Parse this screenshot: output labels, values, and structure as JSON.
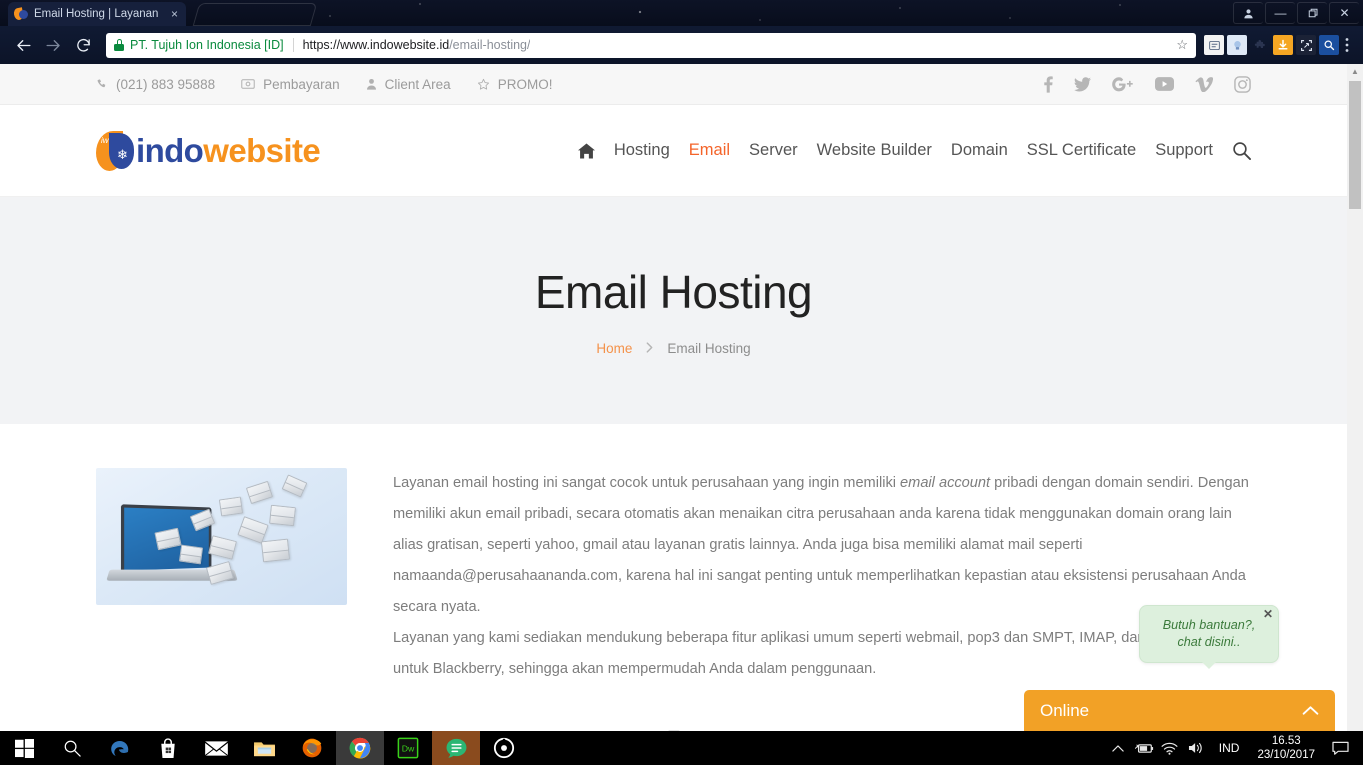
{
  "browser": {
    "tab": {
      "title": "Email Hosting | Layanan",
      "favicon": "indowebsite-favicon",
      "close": "×"
    },
    "nav": {
      "back": "←",
      "forward": "→",
      "reload": "⟳"
    },
    "omnibox": {
      "security_label": "PT. Tujuh Ion Indonesia [ID]",
      "url_host": "https://www.indowebsite.id",
      "url_path": "/email-hosting/",
      "bookmark_star": "☆"
    },
    "extensions": [
      "reader-icon",
      "lamp-icon",
      "puzzle-icon",
      "download-icon",
      "screenshot-icon",
      "search-ext-icon"
    ],
    "menu": "⋮",
    "window_controls": {
      "profile": "●",
      "minimize": "—",
      "restore": "❐",
      "close": "✕"
    }
  },
  "topbar": {
    "links": [
      {
        "label": "(021) 883 95888",
        "icon": "phone-icon"
      },
      {
        "label": "Pembayaran",
        "icon": "card-icon"
      },
      {
        "label": "Client Area",
        "icon": "user-icon"
      },
      {
        "label": "PROMO!",
        "icon": "star-icon"
      }
    ],
    "socials": [
      "facebook-icon",
      "twitter-icon",
      "googleplus-icon",
      "youtube-icon",
      "vimeo-icon",
      "instagram-icon"
    ]
  },
  "header": {
    "logo": {
      "badge": "iw",
      "text_primary": "indo",
      "text_secondary": "website"
    },
    "nav": [
      {
        "label": "",
        "icon": "home-icon",
        "active": false
      },
      {
        "label": "Hosting",
        "active": false
      },
      {
        "label": "Email",
        "active": true
      },
      {
        "label": "Server",
        "active": false
      },
      {
        "label": "Website Builder",
        "active": false
      },
      {
        "label": "Domain",
        "active": false
      },
      {
        "label": "SSL Certificate",
        "active": false
      },
      {
        "label": "Support",
        "active": false
      }
    ],
    "search_icon": "search-icon"
  },
  "hero": {
    "title": "Email Hosting",
    "breadcrumb": {
      "home": "Home",
      "separator": "›",
      "current": "Email Hosting"
    }
  },
  "content": {
    "image_alt": "laptop-with-flying-envelopes",
    "paragraph1_a": "Layanan email hosting ini sangat cocok untuk perusahaan yang ingin memiliki ",
    "paragraph1_em": "email account",
    "paragraph1_b": " pribadi dengan domain sendiri. Dengan memiliki akun email pribadi, secara otomatis akan menaikan citra perusahaan anda karena tidak menggunakan domain orang lain alias gratisan, seperti yahoo, gmail atau layanan gratis lainnya. Anda juga bisa memiliki alamat mail seperti namaanda@perusahaananda.com, karena hal ini sangat penting untuk memperlihatkan kepastian atau eksistensi perusahaan Anda secara nyata.",
    "paragraph2": "Layanan yang kami sediakan mendukung beberapa fitur aplikasi umum seperti webmail, pop3 dan SMPT, IMAP, dan push mail untuk Blackberry, sehingga akan mempermudah Anda dalam penggunaan.",
    "divider_icon": "monitor-icon"
  },
  "chat": {
    "bubble_line1": "Butuh bantuan?,",
    "bubble_line2": "chat disini..",
    "close": "✕",
    "status_label": "Online",
    "chevron": "chevron-up-icon"
  },
  "taskbar": {
    "items": [
      {
        "name": "start-button",
        "icon": "windows-icon"
      },
      {
        "name": "search-button",
        "icon": "search-icon"
      },
      {
        "name": "edge-button",
        "icon": "edge-icon"
      },
      {
        "name": "store-button",
        "icon": "store-icon"
      },
      {
        "name": "mail-button",
        "icon": "mail-icon"
      },
      {
        "name": "explorer-button",
        "icon": "folder-icon"
      },
      {
        "name": "firefox-button",
        "icon": "firefox-icon"
      },
      {
        "name": "chrome-button",
        "icon": "chrome-icon"
      },
      {
        "name": "dreamweaver-button",
        "icon": "dreamweaver-icon",
        "label": "Dw"
      },
      {
        "name": "chat-app-button",
        "icon": "chat-app-icon"
      },
      {
        "name": "media-app-button",
        "icon": "circle-target-icon"
      }
    ],
    "tray": {
      "overflow": "show-hidden-icons",
      "icons": [
        "battery-icon",
        "wifi-icon",
        "volume-icon"
      ],
      "language": "IND",
      "time": "16.53",
      "date": "23/10/2017",
      "notifications": "action-center-icon"
    }
  },
  "colors": {
    "accent_orange": "#f4642a",
    "brand_blue": "#2e4a9e",
    "brand_orange": "#f6921e",
    "chat_green": "#ddf0dd",
    "chat_bar": "#f2a126"
  }
}
